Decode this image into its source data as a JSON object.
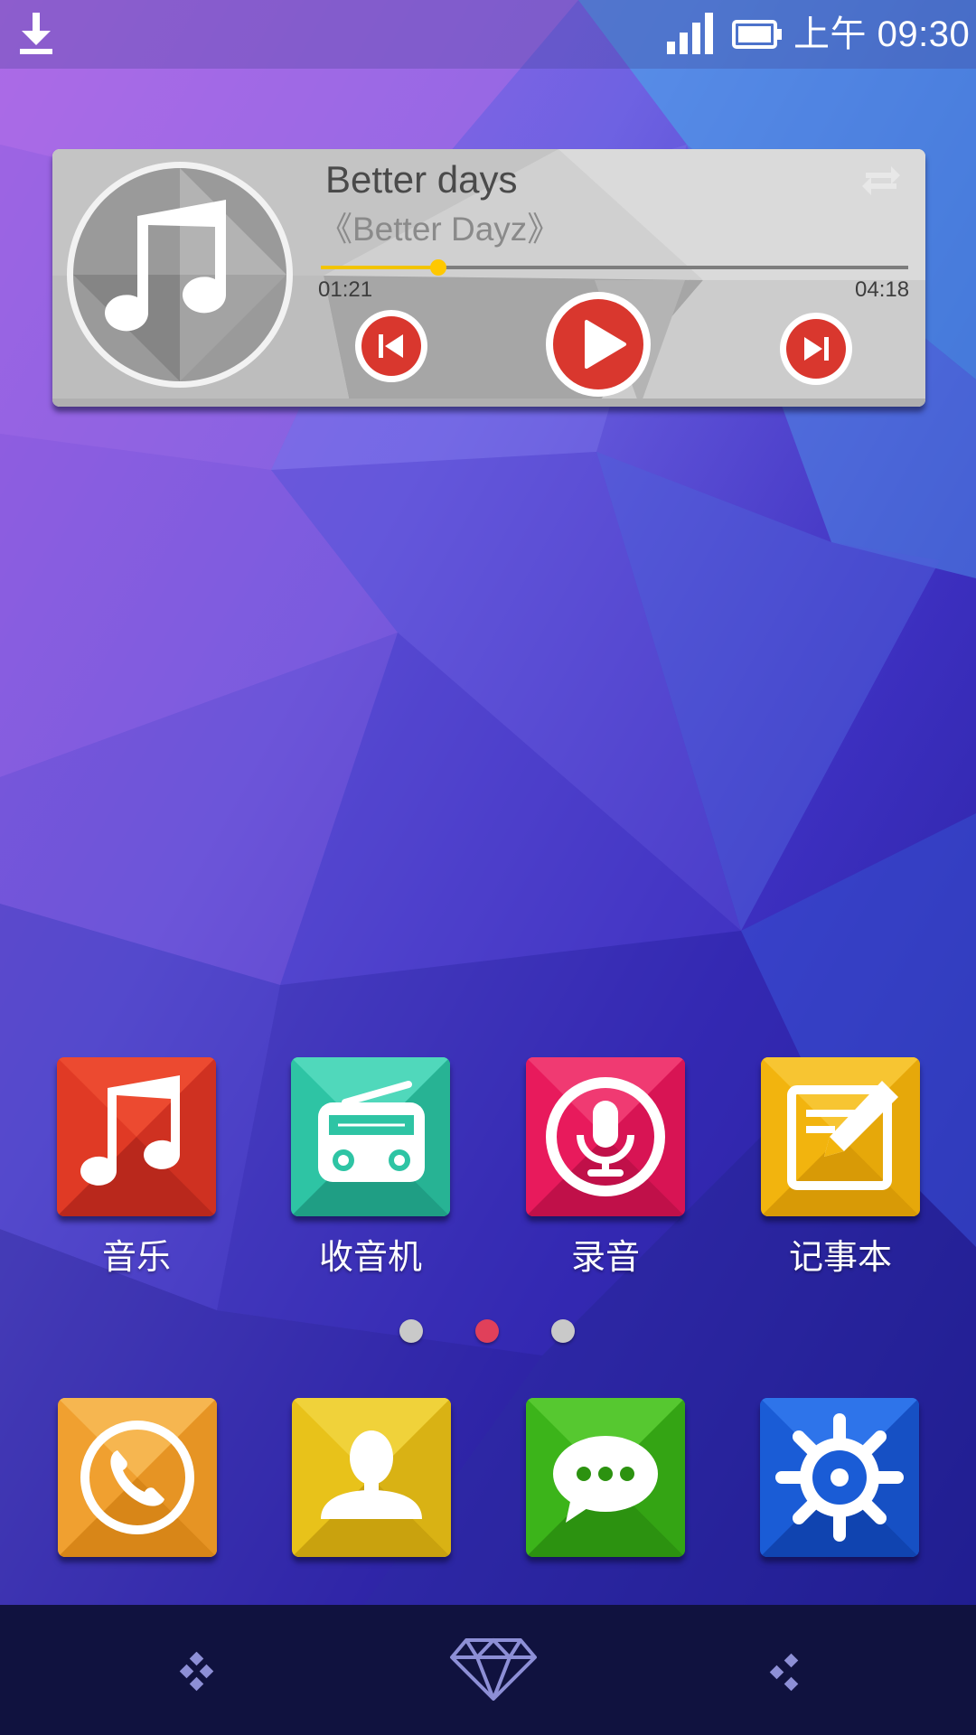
{
  "status_bar": {
    "download_icon": "download-icon",
    "signal_icon": "signal-strength-icon",
    "battery_icon": "battery-icon",
    "time": "上午 09:30"
  },
  "music_widget": {
    "song_title": "Better days",
    "album": "《Better Dayz》",
    "elapsed": "01:21",
    "total": "04:18",
    "progress": 0.2,
    "album_art_icon": "music-note-icon",
    "repeat_icon": "repeat-icon",
    "prev_icon": "skip-previous-icon",
    "play_icon": "play-icon",
    "next_icon": "skip-next-icon",
    "accent_color": "#d9372e"
  },
  "apps": [
    {
      "label": "音乐",
      "icon": "music-note-icon",
      "color": "#e23a24"
    },
    {
      "label": "收音机",
      "icon": "radio-icon",
      "color": "#2ec4a4"
    },
    {
      "label": "录音",
      "icon": "microphone-icon",
      "color": "#e81a5c"
    },
    {
      "label": "记事本",
      "icon": "notepad-icon",
      "color": "#f2b40e"
    }
  ],
  "page_indicator": {
    "count": 3,
    "active": 2
  },
  "dock": [
    {
      "icon": "phone-icon",
      "color": "#f0a030"
    },
    {
      "icon": "contacts-icon",
      "color": "#e8c21a"
    },
    {
      "icon": "messages-icon",
      "color": "#3cb41a"
    },
    {
      "icon": "settings-icon",
      "color": "#1a5cd6"
    }
  ],
  "nav_bar": {
    "left_icon": "menu-dots-icon",
    "center_icon": "diamond-home-icon",
    "right_icon": "back-dots-icon"
  }
}
